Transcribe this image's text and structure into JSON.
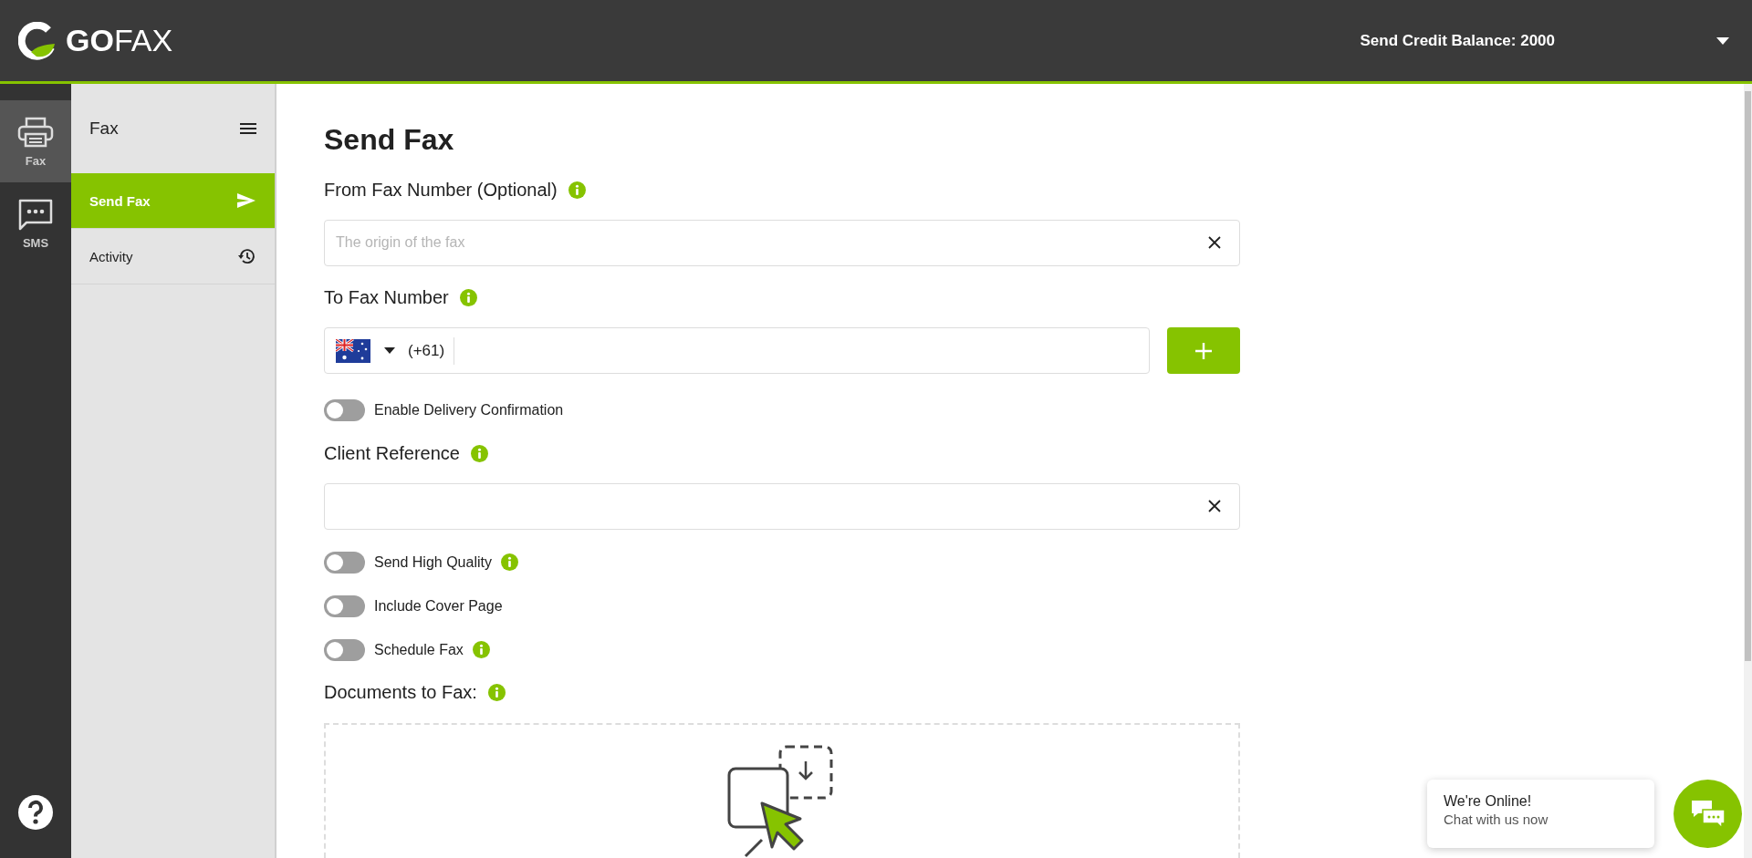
{
  "header": {
    "logo_text": "**GO**FAX",
    "credit_balance": "Send Credit Balance: 2000"
  },
  "rail": {
    "items": [
      {
        "label": "Fax",
        "selected": true
      },
      {
        "label": "SMS",
        "selected": false
      }
    ]
  },
  "sidebar": {
    "title": "Fax",
    "items": [
      {
        "label": "Send Fax",
        "selected": true
      },
      {
        "label": "Activity",
        "selected": false
      }
    ]
  },
  "form": {
    "title": "Send Fax",
    "rows": [
      {
        "kind": "label",
        "text": "From Fax Number (Optional)",
        "info": true
      },
      {
        "kind": "text_field",
        "placeholder": "The origin of the fax"
      },
      {
        "kind": "label",
        "text": "To Fax Number",
        "info": true
      },
      {
        "kind": "phone_field",
        "dial_code": "(+61)"
      },
      {
        "kind": "toggle",
        "label": "Enable Delivery Confirmation",
        "on": false,
        "info": false
      },
      {
        "kind": "label",
        "text": "Client Reference",
        "info": true
      },
      {
        "kind": "text_field"
      },
      {
        "kind": "toggle",
        "label": "Send High Quality",
        "on": false,
        "info": true
      },
      {
        "kind": "toggle",
        "label": "Include Cover Page",
        "on": false,
        "info": false
      },
      {
        "kind": "toggle",
        "label": "Schedule Fax",
        "on": false,
        "info": true
      },
      {
        "kind": "label",
        "text": "Documents to Fax:",
        "info": true
      },
      {
        "kind": "dropzone"
      }
    ]
  },
  "chat": {
    "title": "We're Online!",
    "subtitle": "Chat with us now"
  }
}
